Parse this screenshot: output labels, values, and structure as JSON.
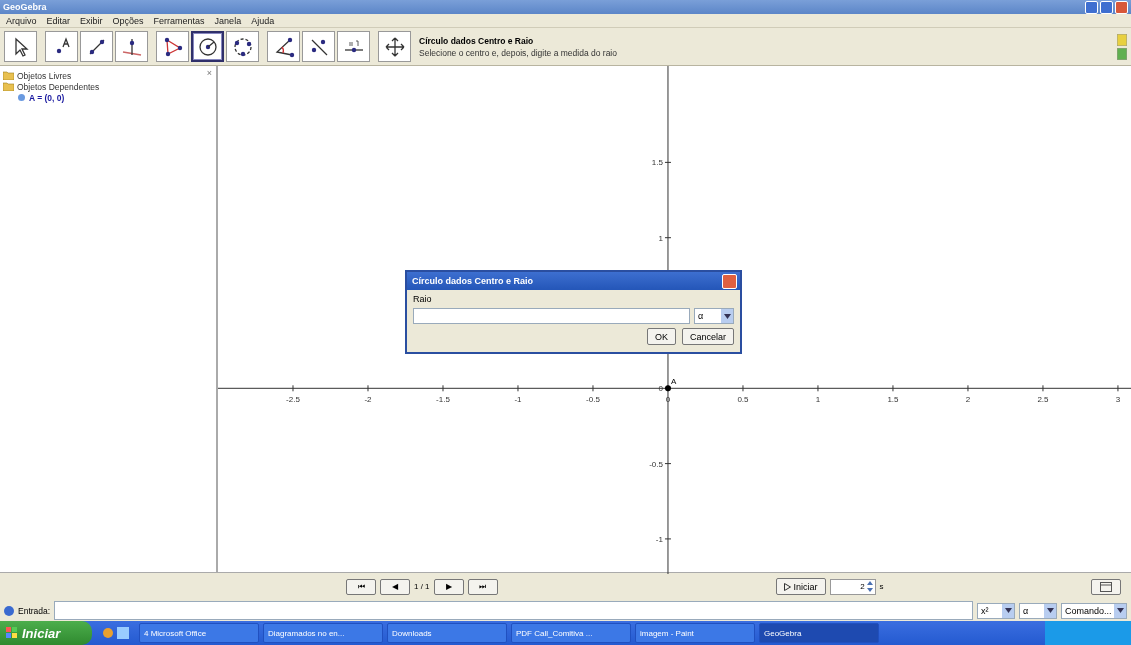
{
  "window": {
    "title": "GeoGebra"
  },
  "menu": [
    "Arquivo",
    "Editar",
    "Exibir",
    "Opções",
    "Ferramentas",
    "Janela",
    "Ajuda"
  ],
  "toolbar": {
    "groups": [
      [
        {
          "kind": "pointer",
          "selected": false
        }
      ],
      [
        {
          "kind": "point",
          "selected": false
        },
        {
          "kind": "line",
          "selected": false
        },
        {
          "kind": "perpendicular",
          "selected": false
        }
      ],
      [
        {
          "kind": "polygon",
          "selected": false
        },
        {
          "kind": "circle",
          "selected": true
        },
        {
          "kind": "circle3",
          "selected": false
        }
      ],
      [
        {
          "kind": "angle",
          "selected": false
        },
        {
          "kind": "reflect",
          "selected": false
        },
        {
          "kind": "slider",
          "selected": false
        }
      ],
      [
        {
          "kind": "move",
          "selected": false
        }
      ]
    ],
    "help_title": "Círculo dados Centro e Raio",
    "help_text": "Selecione o centro e, depois, digite a medida do raio"
  },
  "algebra": {
    "items": [
      {
        "label": "Objetos Livres"
      },
      {
        "label": "Objetos Dependentes",
        "children": [
          {
            "label": "A = (0, 0)"
          }
        ]
      }
    ],
    "close": "×"
  },
  "graphics": {
    "chart_data": {
      "type": "scatter",
      "x": [
        0
      ],
      "series": [
        {
          "name": "A",
          "color": "#000000",
          "values": [
            0
          ]
        }
      ],
      "xlim": [
        -3.0,
        3.087
      ],
      "ylim": [
        -1.233,
        2.14
      ],
      "xticks": [
        {
          "value": -2.5,
          "label": "-2.5"
        },
        {
          "value": -2,
          "label": "-2"
        },
        {
          "value": -1.5,
          "label": "-1.5"
        },
        {
          "value": -1,
          "label": "-1"
        },
        {
          "value": -0.5,
          "label": "-0.5"
        },
        {
          "value": 0,
          "label": "0"
        },
        {
          "value": 0.5,
          "label": "0.5"
        },
        {
          "value": 1,
          "label": "1"
        },
        {
          "value": 1.5,
          "label": "1.5"
        },
        {
          "value": 2,
          "label": "2"
        },
        {
          "value": 2.5,
          "label": "2.5"
        },
        {
          "value": 3,
          "label": "3"
        }
      ],
      "yticks": [
        {
          "value": 1.5,
          "label": "1.5"
        },
        {
          "value": 1,
          "label": "1"
        },
        {
          "value": 0,
          "label": "0"
        },
        {
          "value": -0.5,
          "label": "-0.5"
        },
        {
          "value": -1,
          "label": "-1"
        }
      ]
    }
  },
  "dialog": {
    "title": "Círculo dados Centro e Raio",
    "label": "Raio",
    "symbol": "α",
    "buttons": [
      "OK",
      "Cancelar"
    ]
  },
  "construction_bar": {
    "nav": [
      "⏮",
      "◀",
      "▶",
      "⏭"
    ],
    "page": "1 / 1",
    "play": "Iniciar",
    "speed": "2",
    "unit": "s"
  },
  "input_bar": {
    "label": "Entrada:",
    "dropdowns": [
      "x²",
      "α",
      "Comando..."
    ]
  },
  "taskbar": {
    "start": "Iniciar",
    "items": [
      {
        "label": "4 Microsoft Office",
        "selected": false
      },
      {
        "label": "Diagramados no en...",
        "selected": false
      },
      {
        "label": "Downloads",
        "selected": false
      },
      {
        "label": "PDF Call_Comitiva ...",
        "selected": false
      },
      {
        "label": "imagem - Paint",
        "selected": false
      },
      {
        "label": "GeoGebra",
        "selected": true
      }
    ]
  }
}
